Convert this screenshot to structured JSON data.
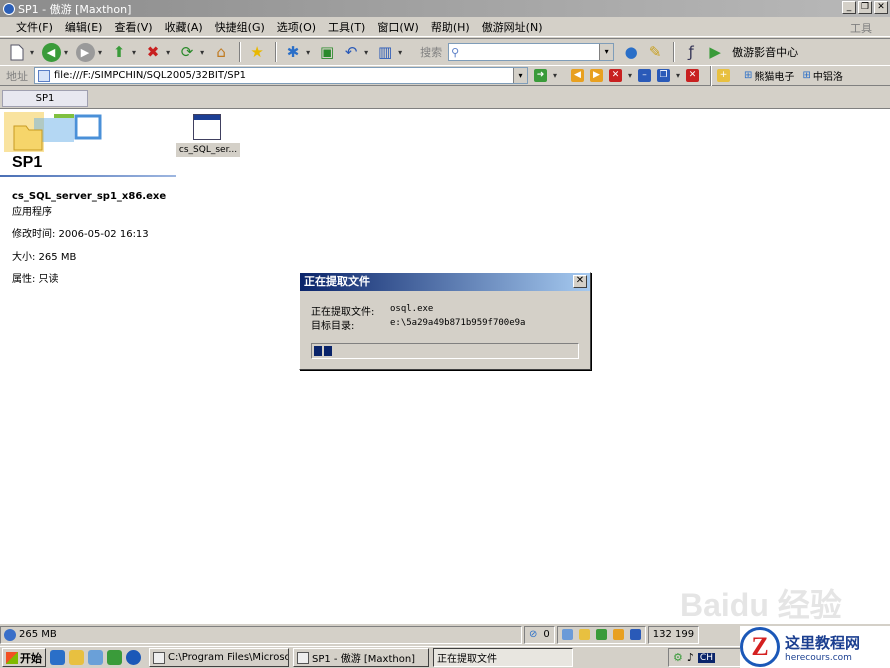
{
  "window": {
    "title": "SP1 - 傲游 [Maxthon]",
    "controls": [
      "_",
      "❐",
      "✕"
    ]
  },
  "menubar": {
    "items": [
      "文件(F)",
      "编辑(E)",
      "查看(V)",
      "收藏(A)",
      "快捷组(G)",
      "选项(O)",
      "工具(T)",
      "窗口(W)",
      "帮助(H)",
      "傲游网址(N)"
    ],
    "right_label": "工具"
  },
  "toolbar": {
    "search_label": "搜索",
    "search_value": "",
    "media_label": "傲游影音中心"
  },
  "addressbar": {
    "label": "地址",
    "url": "file:///F:/SIMPCHIN/SQL2005/32BIT/SP1",
    "links": [
      "熊猫电子",
      "中铝洛"
    ]
  },
  "tabs": [
    {
      "label": "SP1"
    }
  ],
  "folder": {
    "title": "SP1",
    "file_name": "cs_SQL_server_sp1_x86.exe",
    "file_type": "应用程序",
    "modified": "修改时间: 2006-05-02 16:13",
    "size": "大小: 265 MB",
    "attributes": "属性: 只读",
    "icon_label": "cs_SQL_ser..."
  },
  "dialog": {
    "title": "正在提取文件",
    "close": "✕",
    "extracting_label": "正在提取文件:",
    "extracting_value": "osql.exe",
    "target_label": "目标目录:",
    "target_value": "e:\\5a29a49b871b959f700e9a",
    "progress": 0.08
  },
  "watermark": "Baidu 经验",
  "statusbar": {
    "size_text": "265 MB",
    "count": "0",
    "coords": "132 199"
  },
  "taskbar": {
    "start_label": "开始",
    "tasks": [
      {
        "label": "C:\\Program Files\\Microsof...",
        "active": false
      },
      {
        "label": "SP1 - 傲游 [Maxthon]",
        "active": false
      },
      {
        "label": "正在提取文件",
        "active": true
      }
    ],
    "ime": "CH"
  },
  "site_logo": {
    "letter": "Z",
    "name": "这里教程网",
    "url": "herecours.com"
  }
}
